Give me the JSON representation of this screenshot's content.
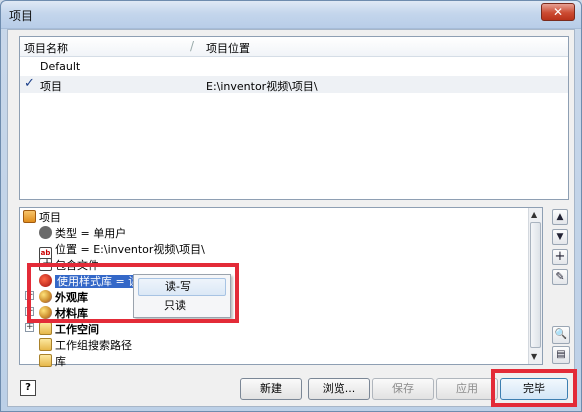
{
  "window": {
    "title": "项目",
    "close_label": "✕"
  },
  "project_list": {
    "columns": [
      "项目名称",
      "项目位置"
    ],
    "rows": [
      {
        "name": "Default",
        "location": "",
        "checked": false
      },
      {
        "name": "项目",
        "location": "E:\\inventor视频\\项目\\",
        "checked": true
      }
    ],
    "check_mark": "✓"
  },
  "tree": {
    "items": [
      {
        "label": "项目",
        "icon": "project-icon"
      },
      {
        "label": "类型 = 单用户",
        "icon": "user-type-icon"
      },
      {
        "label": "位置 = E:\\inventor视频\\项目\\",
        "icon": "location-icon"
      },
      {
        "label": "包含文件 =",
        "icon": "include-file-icon"
      },
      {
        "label": "使用样式库 = 读-写",
        "icon": "style-library-icon"
      },
      {
        "label": "外观库",
        "icon": "appearance-library-icon"
      },
      {
        "label": "材料库",
        "icon": "material-library-icon"
      },
      {
        "label": "工作空间",
        "icon": "folder-icon"
      },
      {
        "label": "工作组搜索路径",
        "icon": "folder-icon"
      },
      {
        "label": "库",
        "icon": "folder-icon"
      }
    ]
  },
  "context_menu": {
    "items": [
      "读-写",
      "只读"
    ]
  },
  "side_buttons": {
    "up": "▲",
    "down": "▼",
    "add": "+",
    "edit": "✎",
    "find": "🔍",
    "options": "▤"
  },
  "buttons": {
    "help": "?",
    "new": "新建",
    "browse": "浏览...",
    "save": "保存",
    "apply": "应用",
    "done": "完毕"
  },
  "colors": {
    "selection": "#3468c8",
    "annotation_frame": "#e32b38"
  }
}
